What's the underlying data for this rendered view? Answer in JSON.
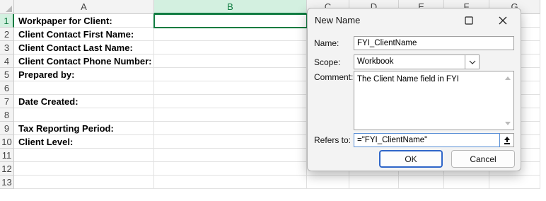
{
  "sheet": {
    "corner_label": "",
    "columns": [
      {
        "label": "A",
        "active": false
      },
      {
        "label": "B",
        "active": true
      },
      {
        "label": "C",
        "active": false
      },
      {
        "label": "D",
        "active": false
      },
      {
        "label": "E",
        "active": false
      },
      {
        "label": "F",
        "active": false
      },
      {
        "label": "G",
        "active": false
      }
    ],
    "rows": [
      {
        "num": "1",
        "a": "Workpaper for Client:"
      },
      {
        "num": "2",
        "a": "Client Contact First Name:"
      },
      {
        "num": "3",
        "a": "Client Contact Last Name:"
      },
      {
        "num": "4",
        "a": "Client Contact Phone Number:"
      },
      {
        "num": "5",
        "a": "Prepared by:"
      },
      {
        "num": "6",
        "a": ""
      },
      {
        "num": "7",
        "a": "Date Created:"
      },
      {
        "num": "8",
        "a": ""
      },
      {
        "num": "9",
        "a": "Tax Reporting Period:"
      },
      {
        "num": "10",
        "a": "Client Level:"
      },
      {
        "num": "11",
        "a": ""
      },
      {
        "num": "12",
        "a": ""
      },
      {
        "num": "13",
        "a": ""
      }
    ],
    "selected_cell": "B1",
    "accent_color": "#107c41"
  },
  "dialog": {
    "title": "New Name",
    "maximize_icon": "maximize-icon",
    "close_icon": "close-icon",
    "name_label": "Name:",
    "name_value": "FYI_ClientName",
    "scope_label": "Scope:",
    "scope_value": "Workbook",
    "comment_label": "Comment:",
    "comment_value": "The Client Name field in FYI",
    "refers_label": "Refers to:",
    "refers_value": "=\"FYI_ClientName\"",
    "ok_label": "OK",
    "cancel_label": "Cancel",
    "primary_color": "#2f66c9"
  }
}
